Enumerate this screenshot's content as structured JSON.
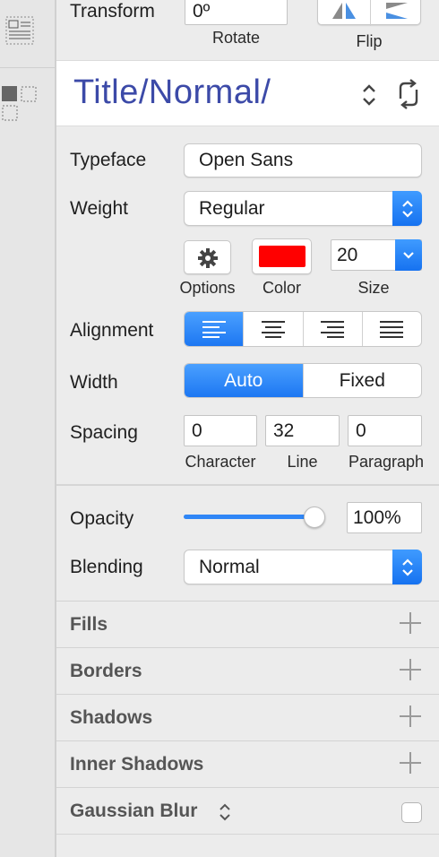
{
  "transform": {
    "label": "Transform",
    "rotate_value": "0º",
    "rotate_label": "Rotate",
    "flip_label": "Flip"
  },
  "style": {
    "name": "Title/Normal/"
  },
  "text": {
    "typeface_label": "Typeface",
    "typeface_value": "Open Sans",
    "weight_label": "Weight",
    "weight_value": "Regular",
    "options_label": "Options",
    "color_label": "Color",
    "color_value": "#ff0000",
    "size_value": "20",
    "size_label": "Size",
    "alignment_label": "Alignment",
    "width_label": "Width",
    "width_auto": "Auto",
    "width_fixed": "Fixed",
    "spacing_label": "Spacing",
    "character_value": "0",
    "character_label": "Character",
    "line_value": "32",
    "line_label": "Line",
    "paragraph_value": "0",
    "paragraph_label": "Paragraph"
  },
  "appearance": {
    "opacity_label": "Opacity",
    "opacity_value": "100%",
    "opacity_level": 1.0,
    "blending_label": "Blending",
    "blending_value": "Normal"
  },
  "sections": {
    "fills": "Fills",
    "borders": "Borders",
    "shadows": "Shadows",
    "inner_shadows": "Inner Shadows",
    "gaussian_blur": "Gaussian Blur"
  },
  "colors": {
    "accent": "#1d77f2",
    "style_name": "#3c4aa8"
  }
}
